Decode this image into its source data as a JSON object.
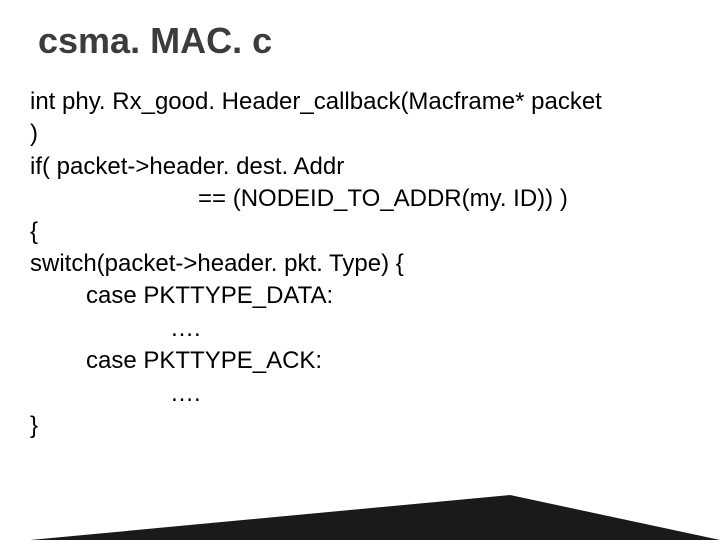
{
  "slide": {
    "title": "csma. MAC. c",
    "code": {
      "line1": "int phy. Rx_good. Header_callback(Macframe* packet",
      "line2": ")",
      "line3": "if( packet->header. dest. Addr",
      "line4": "== (NODEID_TO_ADDR(my. ID)) )",
      "line5": "{",
      "line6": "switch(packet->header. pkt. Type) {",
      "line7": "case PKTTYPE_DATA:",
      "line8": "….",
      "line9": "case PKTTYPE_ACK:",
      "line10": "….",
      "line11": "}"
    }
  }
}
